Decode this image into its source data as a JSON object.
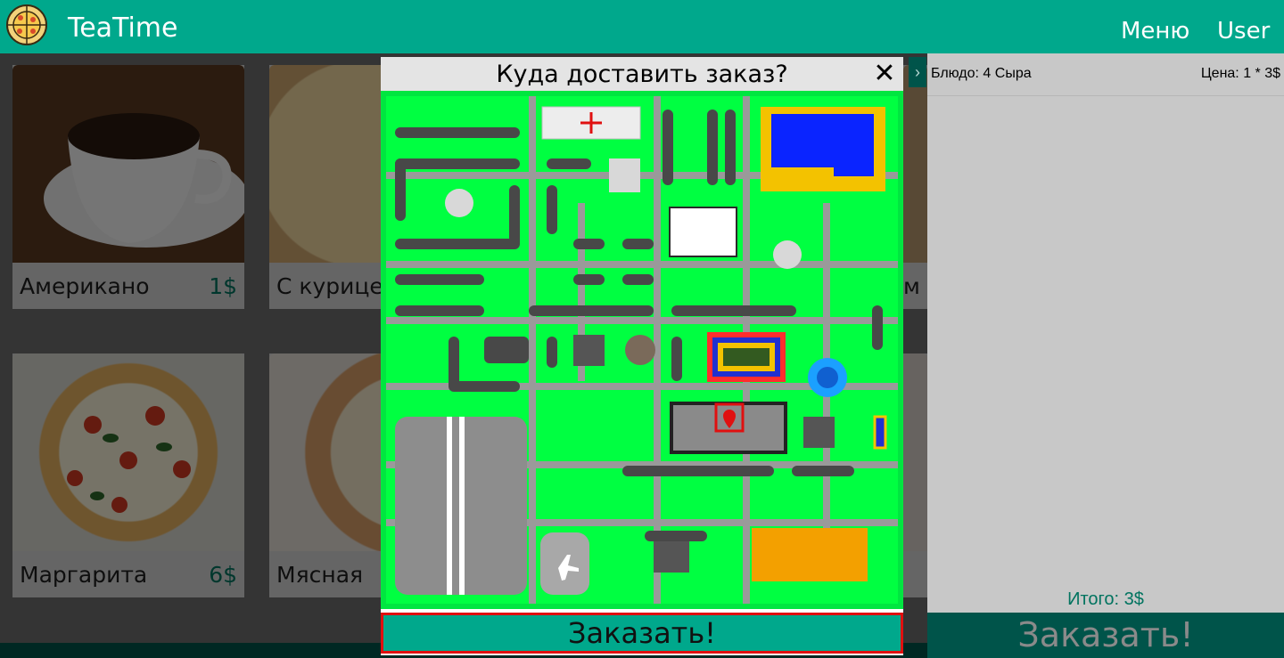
{
  "header": {
    "brand": "TeaTime",
    "menu": "Меню",
    "user": "User"
  },
  "products": [
    {
      "name": "Американо",
      "price": "1$"
    },
    {
      "name": "С курицей",
      "price": ""
    },
    {
      "name": "Маргарита",
      "price": "6$"
    },
    {
      "name": "Мясная",
      "price": ""
    }
  ],
  "partial_card_text": "м",
  "modal": {
    "title": "Куда доставить заказ?",
    "close": "✕",
    "order_label": "Заказать!"
  },
  "cart": {
    "dish": "Блюдо: 4 Сыра",
    "price": "Цена: 1 * 3$",
    "total": "Итого: 3$",
    "order_label": "Заказать!"
  },
  "map": {
    "selected_marker": "location-pin-icon",
    "colors": {
      "grass": "#00ff41",
      "road": "#4a4a4a",
      "accent": "#00a88c"
    }
  }
}
